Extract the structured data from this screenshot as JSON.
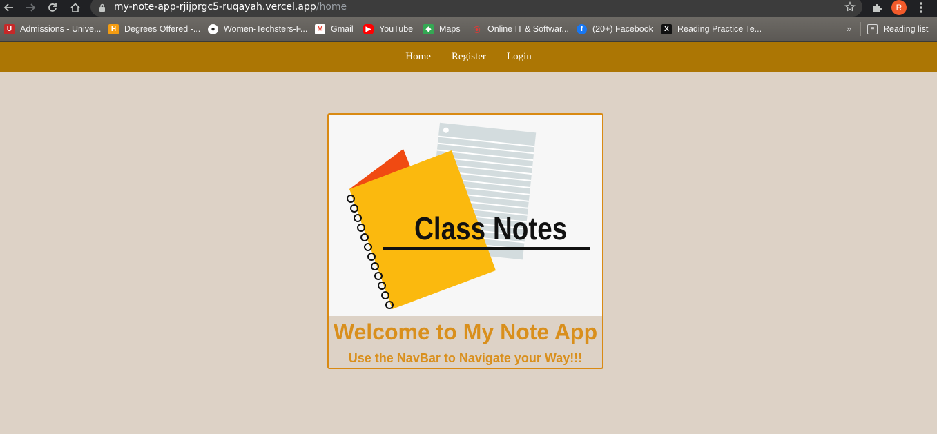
{
  "browser": {
    "url_host": "my-note-app-rjijprgc5-ruqayah.vercel.app",
    "url_path": "/home",
    "profile_initial": "R",
    "bookmarks": [
      {
        "label": "Admissions - Unive...",
        "icon": "university-favicon",
        "color": "#c62828"
      },
      {
        "label": "Degrees Offered -...",
        "icon": "degrees-favicon",
        "color": "#f39c12"
      },
      {
        "label": "Women-Techsters-F...",
        "icon": "github-favicon",
        "color": "#ffffff"
      },
      {
        "label": "Gmail",
        "icon": "gmail-favicon",
        "color": "#ea4335"
      },
      {
        "label": "YouTube",
        "icon": "youtube-favicon",
        "color": "#ff0000"
      },
      {
        "label": "Maps",
        "icon": "maps-favicon",
        "color": "#34a853"
      },
      {
        "label": "Online IT & Softwar...",
        "icon": "online-it-favicon",
        "color": "#e53935"
      },
      {
        "label": "(20+) Facebook",
        "icon": "facebook-favicon",
        "color": "#1877f2"
      },
      {
        "label": "Reading Practice Te...",
        "icon": "reading-practice-favicon",
        "color": "#111111"
      }
    ],
    "reading_list_label": "Reading list"
  },
  "app_nav": {
    "items": [
      "Home",
      "Register",
      "Login"
    ]
  },
  "card": {
    "image_text": "Class Notes",
    "title": "Welcome to My Note App",
    "subtitle": "Use the NavBar to Navigate your Way!!!"
  },
  "colors": {
    "navbar": "#ac7604",
    "page_bg": "#ddd2c6",
    "accent": "#d98f1c"
  }
}
